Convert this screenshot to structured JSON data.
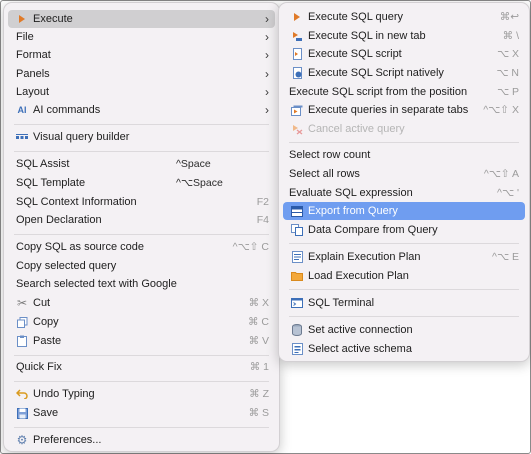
{
  "main_menu": {
    "items": [
      {
        "label": "Execute",
        "icon": "play-icon"
      },
      {
        "label": "File"
      },
      {
        "label": "Format"
      },
      {
        "label": "Panels"
      },
      {
        "label": "Layout"
      },
      {
        "label": "AI commands",
        "icon": "ai-icon"
      },
      {
        "label": "Visual query builder",
        "icon": "query-builder-icon"
      },
      {
        "label": "SQL Assist",
        "shortcut": "^Space"
      },
      {
        "label": "SQL Template",
        "shortcut": "^⌥Space"
      },
      {
        "label": "SQL Context Information",
        "shortcut": "F2"
      },
      {
        "label": "Open Declaration",
        "shortcut": "F4"
      },
      {
        "label": "Copy SQL as source code",
        "shortcut": "^⌥⇧ C"
      },
      {
        "label": "Copy selected query"
      },
      {
        "label": "Search selected text with Google"
      },
      {
        "label": "Cut",
        "icon": "scissors-icon",
        "shortcut": "⌘ X"
      },
      {
        "label": "Copy",
        "icon": "copy-icon",
        "shortcut": "⌘ C"
      },
      {
        "label": "Paste",
        "icon": "paste-icon",
        "shortcut": "⌘ V"
      },
      {
        "label": "Quick Fix",
        "shortcut": "⌘ 1"
      },
      {
        "label": "Undo Typing",
        "icon": "undo-icon",
        "shortcut": "⌘ Z"
      },
      {
        "label": "Save",
        "icon": "save-icon",
        "shortcut": "⌘ S"
      },
      {
        "label": "Preferences...",
        "icon": "gear-icon"
      }
    ]
  },
  "sub_menu": {
    "items": [
      {
        "label": "Execute SQL query",
        "icon": "play-icon",
        "shortcut": "⌘↩"
      },
      {
        "label": "Execute SQL in new tab",
        "icon": "play-new-tab-icon",
        "shortcut": "⌘ \\"
      },
      {
        "label": "Execute SQL script",
        "icon": "script-icon",
        "shortcut": "⌥ X"
      },
      {
        "label": "Execute SQL Script natively",
        "icon": "script-native-icon",
        "shortcut": "⌥ N"
      },
      {
        "label": "Execute SQL script from the position",
        "shortcut": "⌥ P"
      },
      {
        "label": "Execute queries in separate tabs",
        "icon": "tabs-icon",
        "shortcut": "^⌥⇧ X"
      },
      {
        "label": "Cancel active query",
        "icon": "cancel-icon"
      },
      {
        "label": "Select row count"
      },
      {
        "label": "Select all rows",
        "shortcut": "^⌥⇧ A"
      },
      {
        "label": "Evaluate SQL expression",
        "shortcut": "^⌥ '"
      },
      {
        "label": "Export from Query",
        "icon": "export-icon"
      },
      {
        "label": "Data Compare from Query",
        "icon": "compare-icon"
      },
      {
        "label": "Explain Execution Plan",
        "icon": "explain-plan-icon",
        "shortcut": "^⌥ E"
      },
      {
        "label": "Load Execution Plan",
        "icon": "folder-icon"
      },
      {
        "label": "SQL Terminal",
        "icon": "terminal-icon"
      },
      {
        "label": "Set active connection",
        "icon": "database-icon"
      },
      {
        "label": "Select active schema",
        "icon": "schema-icon"
      }
    ]
  },
  "colors": {
    "menu_bg": "#f4f1f4",
    "selection": "#6f9df0",
    "active_parent": "#d0cfd1",
    "play_orange": "#e07a28",
    "icon_blue": "#3d6fb8"
  }
}
